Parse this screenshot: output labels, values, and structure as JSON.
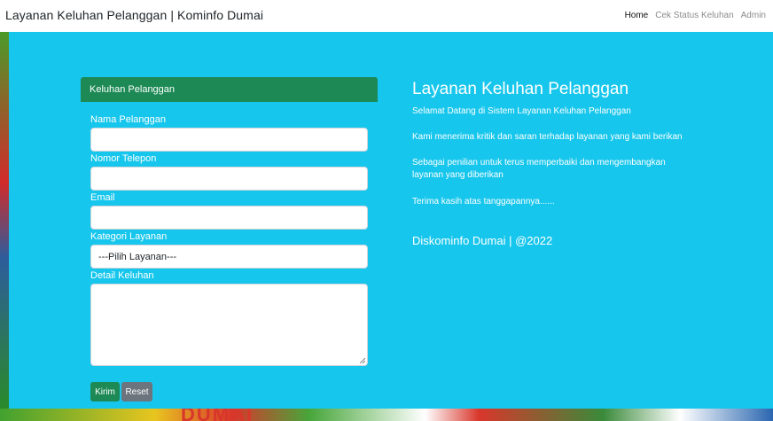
{
  "navbar": {
    "brand": "Layanan Keluhan Pelanggan | Kominfo Dumai",
    "links": [
      {
        "label": "Home",
        "active": true
      },
      {
        "label": "Cek Status Keluhan",
        "active": false
      },
      {
        "label": "Admin",
        "active": false
      }
    ]
  },
  "form": {
    "header": "Keluhan Pelanggan",
    "fields": {
      "nama_label": "Nama Pelanggan",
      "nama_value": "",
      "telepon_label": "Nomor Telepon",
      "telepon_value": "",
      "email_label": "Email",
      "email_value": "",
      "kategori_label": "Kategori Layanan",
      "kategori_selected": "---Pilih Layanan---",
      "detail_label": "Detail Keluhan",
      "detail_value": ""
    },
    "buttons": {
      "submit": "Kirim",
      "reset": "Reset"
    }
  },
  "info": {
    "title": "Layanan Keluhan Pelanggan",
    "p1": "Selamat Datang di Sistem Layanan Keluhan Pelanggan",
    "p2": "Kami menerima kritik dan saran terhadap layanan yang kami berikan",
    "p3": "Sebagai penilian untuk terus memperbaiki dan mengembangkan layanan yang diberikan",
    "p4": "Terima kasih atas tanggapannya......",
    "footer": "Diskominfo Dumai | @2022"
  },
  "background": {
    "banner_text": "DUMAI"
  },
  "colors": {
    "hero": "#17c6ec",
    "accent_green": "#1d8a56",
    "reset_gray": "#6c757d"
  }
}
